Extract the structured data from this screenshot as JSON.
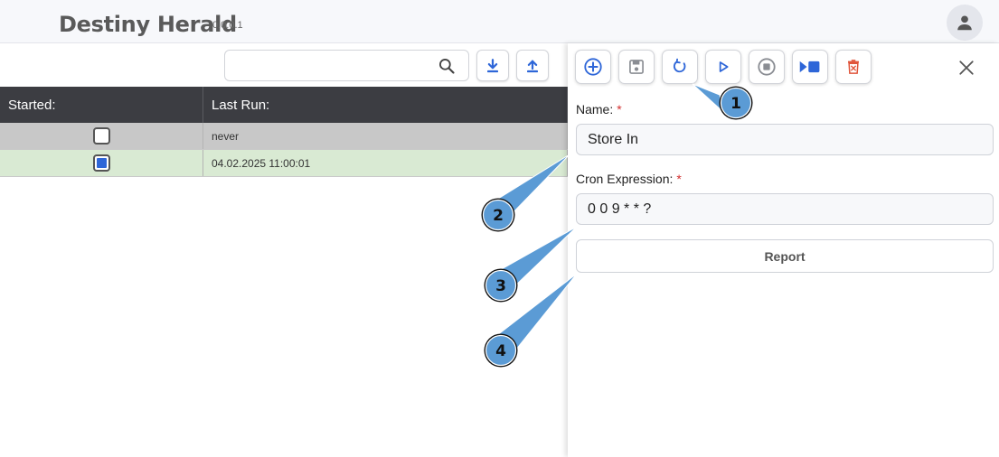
{
  "header": {
    "app_title": "Destiny Herald",
    "version": "0.0.0.1"
  },
  "toolbar": {
    "search_value": "",
    "icons": [
      "search-icon",
      "download-icon",
      "upload-icon"
    ]
  },
  "table": {
    "columns": [
      "Started:",
      "Last Run:"
    ],
    "rows": [
      {
        "started": false,
        "last_run": "never"
      },
      {
        "started": true,
        "last_run": "04.02.2025 11:00:01"
      }
    ]
  },
  "panel": {
    "toolbar_icons": [
      "add-icon",
      "save-icon",
      "refresh-icon",
      "play-icon",
      "stop-icon",
      "run-now-icon",
      "delete-icon",
      "close-icon"
    ],
    "name_label": "Name:",
    "name_value": "Store In",
    "cron_label": "Cron Expression:",
    "cron_value": "0 0 9 * * ?",
    "required_marker": "*",
    "report_label": "Report"
  },
  "callouts": {
    "labels": [
      "1",
      "2",
      "3",
      "4"
    ]
  },
  "colors": {
    "header_bg": "#f7f8fb",
    "table_header_bg": "#3c3d42",
    "row_grey": "#c8c8c8",
    "row_green": "#d9ead3",
    "accent_blue": "#2e66d8",
    "delete_red": "#e0553b",
    "callout_blue": "#5b9bd5"
  }
}
